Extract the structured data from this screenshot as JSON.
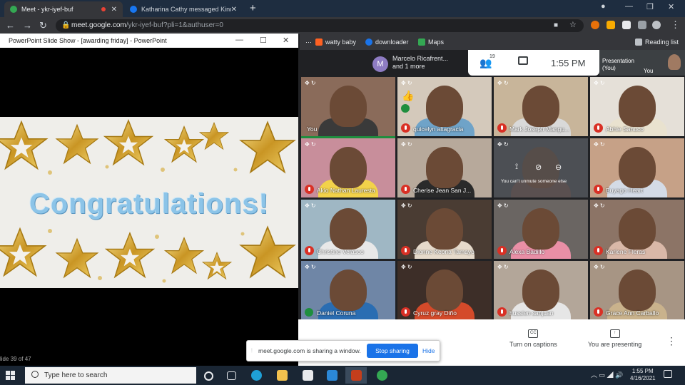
{
  "browser": {
    "tabs": [
      {
        "title": "Meet - ykr-iyef-buf",
        "active": true,
        "favicon_color": "#34a853"
      },
      {
        "title": "Katharina Cathy messaged Kinde",
        "active": false,
        "favicon_color": "#1877f2"
      }
    ],
    "new_tab": "+",
    "url_host": "meet.google.com",
    "url_path": "/ykr-iyef-buf?pli=1&authuser=0",
    "bookmarks": [
      {
        "label": "watty baby",
        "icon": "wattpad-icon",
        "color": "#ff6122"
      },
      {
        "label": "downloader",
        "icon": "downloader-icon",
        "color": "#1a73e8"
      },
      {
        "label": "Maps",
        "icon": "maps-icon",
        "color": "#34a853"
      }
    ],
    "reading_list": "Reading list"
  },
  "powerpoint": {
    "title": "PowerPoint Slide Show - [awarding friday] - PowerPoint",
    "slide_text": "Congratulations!",
    "slide_status": "lide 39 of 47"
  },
  "meet": {
    "presenter": {
      "initial": "M",
      "name_line1": "Marcelo Ricafrent...",
      "name_line2": "and 1 more"
    },
    "participant_count": "19",
    "clock": "1:55 PM",
    "presentation_label_1": "Presentation",
    "presentation_label_2": "(You)",
    "you_label": "You",
    "tiles": [
      {
        "name": "You",
        "muted": false,
        "speaking": false,
        "bg": "#8a6b5a",
        "body": "#3a3a3a"
      },
      {
        "name": "quicelyn altagracia",
        "muted": true,
        "speaking": true,
        "bg": "#d4c9bb",
        "body": "#6fa3c8"
      },
      {
        "name": "Mark Joseph Mangu...",
        "muted": true,
        "speaking": false,
        "bg": "#c8b59a",
        "body": "#d9d9d9"
      },
      {
        "name": "Abhie Sanuco",
        "muted": true,
        "speaking": false,
        "bg": "#e5e0d8",
        "body": "#e9e2cf"
      },
      {
        "name": "Akio Nathan Lauresta",
        "muted": true,
        "speaking": false,
        "bg": "#c88e9b",
        "body": "#f2d24a"
      },
      {
        "name": "Cherise Jean San J...",
        "muted": true,
        "speaking": false,
        "bg": "#b7a99b",
        "body": "#2a2a2a"
      },
      {
        "name": "You can't unmute someone else",
        "muted": false,
        "speaking": false,
        "bg": "#4c4f54",
        "body": "#5a5050"
      },
      {
        "name": "Buyago Heart",
        "muted": true,
        "speaking": false,
        "bg": "#c6a187",
        "body": "#d4dbe6"
      },
      {
        "name": "Christine Velasco",
        "muted": true,
        "speaking": false,
        "bg": "#9fb7c4",
        "body": "#e8e8e8"
      },
      {
        "name": "Dionne Keona Tamayo",
        "muted": true,
        "speaking": false,
        "bg": "#4a3c33",
        "body": "#e6dacb"
      },
      {
        "name": "Alexa Badillo",
        "muted": true,
        "speaking": false,
        "bg": "#6a6562",
        "body": "#e98fa6"
      },
      {
        "name": "Karlene Fleras",
        "muted": true,
        "speaking": false,
        "bg": "#8c7466",
        "body": "#d9b8a8"
      },
      {
        "name": "Daniel Coruna",
        "muted": false,
        "speaking": true,
        "bg": "#6f86a6",
        "body": "#2a6db2"
      },
      {
        "name": "Cyruz gray Diño",
        "muted": true,
        "speaking": false,
        "bg": "#3d2e28",
        "body": "#d44a2a"
      },
      {
        "name": "hussien sanjuan",
        "muted": true,
        "speaking": false,
        "bg": "#b3a699",
        "body": "#e6e6e6"
      },
      {
        "name": "Grace Ann Carballo",
        "muted": true,
        "speaking": false,
        "bg": "#a79584",
        "body": "#c9b28c"
      }
    ],
    "captions_label": "Turn on captions",
    "captions_icon": "CC",
    "presenting_label": "You are presenting"
  },
  "share_bar": {
    "message": "meet.google.com is sharing a window.",
    "stop": "Stop sharing",
    "hide": "Hide"
  },
  "taskbar": {
    "search_placeholder": "Type here to search",
    "time": "1:55 PM",
    "date": "4/16/2021"
  }
}
